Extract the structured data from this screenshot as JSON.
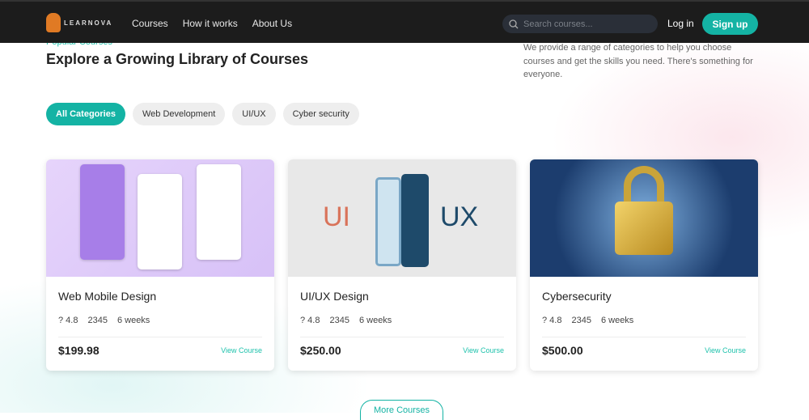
{
  "nav": {
    "brand": "LEARNOVA",
    "links": [
      "Courses",
      "How it works",
      "About Us"
    ],
    "search_placeholder": "Search courses...",
    "login": "Log in",
    "signup": "Sign up"
  },
  "section": {
    "eyebrow": "Popular Courses",
    "title": "Explore a Growing Library of Courses",
    "description": "We provide a range of categories to help you choose courses and get the skills you need. There's something for everyone."
  },
  "categories": [
    "All Categories",
    "Web Development",
    "UI/UX",
    "Cyber security"
  ],
  "courses": [
    {
      "title": "Web Mobile Design",
      "rating": "? 4.8",
      "students": "2345",
      "duration": "6 weeks",
      "price": "$199.98",
      "cta": "View Course"
    },
    {
      "title": "UI/UX Design",
      "rating": "? 4.8",
      "students": "2345",
      "duration": "6 weeks",
      "price": "$250.00",
      "cta": "View Course",
      "image_text": [
        "UI",
        "UX"
      ]
    },
    {
      "title": "Cybersecurity",
      "rating": "? 4.8",
      "students": "2345",
      "duration": "6 weeks",
      "price": "$500.00",
      "cta": "View Course"
    }
  ],
  "more_label": "More Courses",
  "colors": {
    "accent": "#14b3a4",
    "nav": "#1c1c1c"
  }
}
